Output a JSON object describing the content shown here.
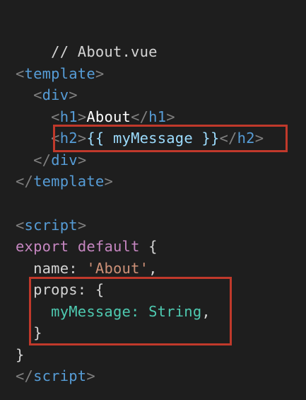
{
  "file_comment": "// About.vue",
  "colors": {
    "background": "#1e1e1e",
    "tag": "#569cd6",
    "punctuation": "#808080",
    "keyword": "#c586c0",
    "string": "#ce9178",
    "identifier": "#9cdcfe",
    "type": "#4ec9b0",
    "highlight_border": "#c0392b"
  },
  "code": {
    "template_open": "template",
    "div_open": "div",
    "h1_tag": "h1",
    "h1_text": "About",
    "h2_tag": "h2",
    "h2_expr": "{{ myMessage }}",
    "div_close": "div",
    "template_close": "template",
    "script_open": "script",
    "export_kw": "export",
    "default_kw": "default",
    "open_brace": "{",
    "name_key": "name:",
    "name_value": "'About'",
    "comma": ",",
    "props_key": "props:",
    "props_open": "{",
    "prop_name": "myMessage:",
    "prop_type": "String",
    "prop_comma": ",",
    "props_close": "}",
    "close_brace": "}",
    "script_close": "script"
  }
}
